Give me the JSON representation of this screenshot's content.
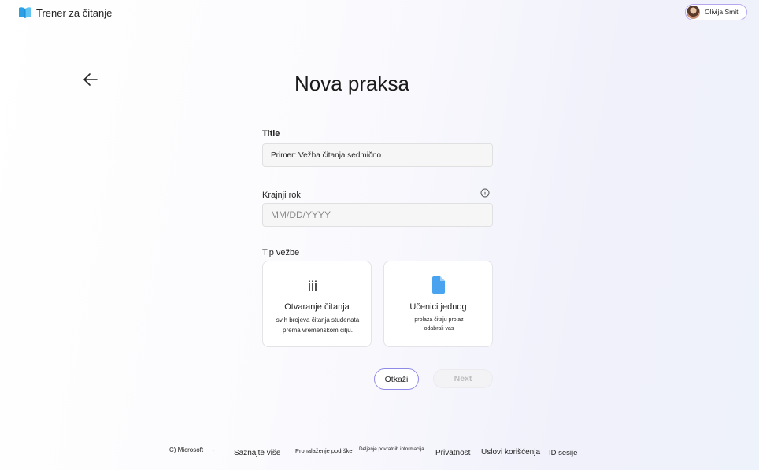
{
  "header": {
    "app_title": "Trener za čitanje",
    "user_name": "Olivija Smit"
  },
  "main": {
    "page_title": "Nova praksa",
    "title_label": "Title",
    "title_value": "Primer: Vežba čitanja sedmično",
    "deadline_label": "Krajnji rok",
    "deadline_placeholder": "MM/DD/YYYY",
    "type_label": "Tip vežbe",
    "cards": [
      {
        "icon": "iii",
        "title": "Otvaranje čitanja",
        "desc_line1": "svih brojeva čitanja studenata",
        "desc_line2": "prema vremenskom cilju."
      },
      {
        "icon": "document-icon",
        "title": "Učenici jednog",
        "desc_line1": "prolaza čitaju prolaz",
        "desc_line2": "odabrali vas"
      }
    ],
    "cancel_label": "Otkaži",
    "next_label": "Next"
  },
  "footer": {
    "copyright": "C) Microsoft",
    "sep": ":",
    "learn_more": "Saznajte više",
    "find_support": "Pronalaženje podrške",
    "share_feedback": "Deljenje povratnih informacija",
    "privacy": "Privatnost",
    "terms": "Uslovi korišćenja",
    "session_id": "ID sesije"
  },
  "colors": {
    "accent": "#8f8ae6",
    "logo_blue": "#2aa0e6",
    "doc_icon": "#4aa3ee"
  }
}
